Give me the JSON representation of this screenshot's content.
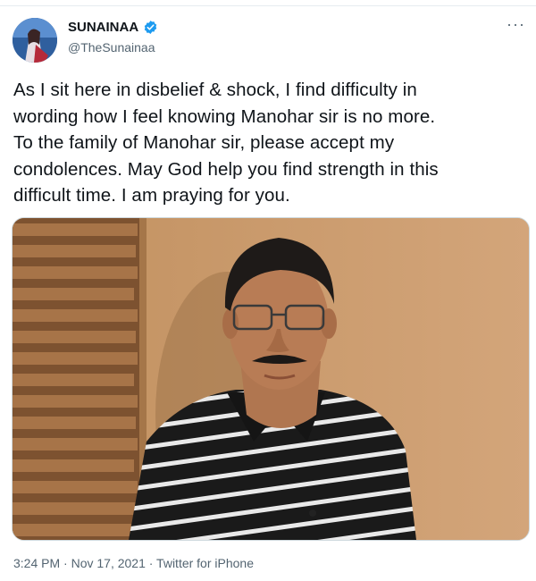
{
  "author": {
    "name": "SUNAINAA",
    "handle": "@TheSunainaa",
    "verified": true
  },
  "more_label": "···",
  "tweet_text": "As I sit here in disbelief & shock, I find difficulty in\nwording how I feel knowing Manohar sir is no more.\nTo the family of Manohar sir, please accept my\ncondolences. May God help you find strength in this\ndifficult time. I am praying for you.",
  "meta": "3:24 PM · Nov 17, 2021 · Twitter for iPhone",
  "colors": {
    "verified_badge": "#1d9bf0",
    "secondary_text": "#536471",
    "wall_tan": "#c99a6c",
    "brick": "#8a5a35"
  }
}
